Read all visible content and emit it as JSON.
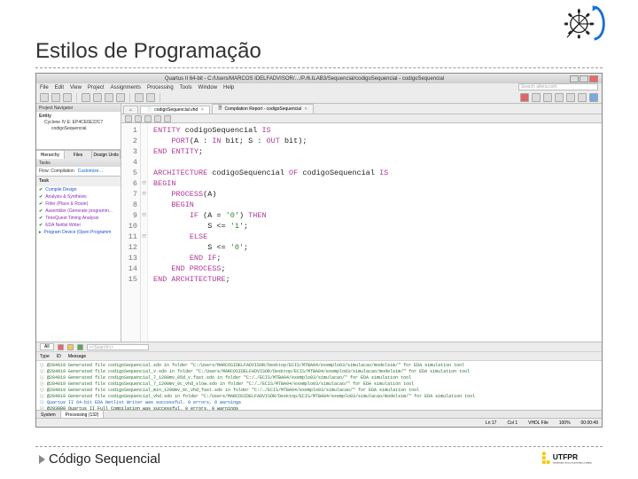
{
  "slide": {
    "title": "Estilos de Programação",
    "caption": "Código Sequencial"
  },
  "brand_top": {
    "name": "gear-compass-logo"
  },
  "brand_bottom": {
    "name": "UTFPR",
    "subtitle": "UNIVERSIDADE TECNOLÓGICA FEDERAL DO PARANÁ"
  },
  "ide": {
    "titlebar": "Quartus II 64-bit - C:/Users/MARCOS IDELFADVISOR/…/P./6.ILAB3/Sequencial/codigoSequencial - codigoSequencial",
    "menu": [
      "File",
      "Edit",
      "View",
      "Project",
      "Assignments",
      "Processing",
      "Tools",
      "Window",
      "Help"
    ],
    "search_placeholder": "Search altera.com",
    "tabs": {
      "active": "codigoSequencial.vhd",
      "inactive": "Compilation Report - codigoSequencial"
    },
    "left": {
      "project_header": "Project Navigator",
      "entity_header": "Entity",
      "device": "Cyclone IV E: EP4CE6E22C7",
      "entity": "codigoSequencial",
      "tabs": [
        "Hierarchy",
        "Files",
        "Design Units"
      ],
      "tasks_header": "Tasks",
      "flow_label": "Flow: Compilation",
      "customize": "Customize…",
      "task_col": "Task",
      "tasks": [
        {
          "ok": true,
          "label": "Compile Design",
          "cls": "task-blue"
        },
        {
          "ok": true,
          "label": "Analysis & Synthesis",
          "cls": "task-purple"
        },
        {
          "ok": true,
          "label": "Fitter (Place & Route)",
          "cls": "task-purple"
        },
        {
          "ok": true,
          "label": "Assembler (Generate programm…",
          "cls": "task-purple"
        },
        {
          "ok": true,
          "label": "TimeQuest Timing Analysis",
          "cls": "task-purple"
        },
        {
          "ok": true,
          "label": "EDA Netlist Writer",
          "cls": "task-purple"
        },
        {
          "ok": false,
          "label": "Program Device (Open Programm",
          "cls": "task-blue"
        }
      ]
    },
    "code": {
      "lines": [
        {
          "n": 1,
          "m": "",
          "html": "<span class='kw'>ENTITY</span> codigoSequencial <span class='kw'>IS</span>"
        },
        {
          "n": 2,
          "m": "",
          "html": "    <span class='kw'>PORT</span>(A : <span class='kw'>IN</span> bit; S : <span class='kw'>OUT</span> bit);"
        },
        {
          "n": 3,
          "m": "",
          "html": "<span class='kw'>END ENTITY</span>;"
        },
        {
          "n": 4,
          "m": "",
          "html": ""
        },
        {
          "n": 5,
          "m": "",
          "html": "<span class='kw'>ARCHITECTURE</span> codigoSequencial <span class='kw'>OF</span> codigoSequencial <span class='kw'>IS</span>"
        },
        {
          "n": 6,
          "m": "⊟",
          "html": "<span class='kw'>BEGIN</span>"
        },
        {
          "n": 7,
          "m": "⊟",
          "html": "    <span class='kw'>PROCESS</span>(A)"
        },
        {
          "n": 8,
          "m": "",
          "html": "    <span class='kw'>BEGIN</span>"
        },
        {
          "n": 9,
          "m": "⊟",
          "html": "        <span class='kw'>IF</span> (A = <span class='lit'>'0'</span>) <span class='kw'>THEN</span>"
        },
        {
          "n": 10,
          "m": "",
          "html": "            S &lt;= <span class='lit'>'1'</span>;"
        },
        {
          "n": 11,
          "m": "⊟",
          "html": "        <span class='kw'>ELSE</span>"
        },
        {
          "n": 12,
          "m": "",
          "html": "            S &lt;= <span class='lit'>'0'</span>;"
        },
        {
          "n": 13,
          "m": "",
          "html": "        <span class='kw'>END IF</span>;"
        },
        {
          "n": 14,
          "m": "",
          "html": "    <span class='kw'>END PROCESS</span>;"
        },
        {
          "n": 15,
          "m": "",
          "html": "<span class='kw'>END ARCHITECTURE</span>;"
        }
      ]
    },
    "bottom": {
      "filter_btn": "All",
      "filter_placeholder": "<<Search>>",
      "tabs": [
        "Type",
        "ID",
        "Message"
      ],
      "messages": [
        "@284019 Generated file codigoSequencial.sdo in folder \"C:/Users/MARCOSIDELFADVISOR/Desktop/ECIS/MTBA04/exemplo03/simulacao/modelsim/\" for EDA simulation tool",
        "@284019 Generated file codigoSequencial_v.sdo in folder \"C:/Users/MARCOSIDELFADVISOR/Desktop/ECIS/MTBA04/exemplo03/simulacao/modelsim/\" for EDA simulation tool",
        "@284019 Generated file codigoSequencial_7_1200mv_85d_v.fast.sdo in folder \"C:/…/ECIS/MTBA04/exemplo03/simulacao/\" for EDA simulation tool",
        "@284019 Generated file codigoSequencial_7_1200mv_0c_vhd_slow.sdo in folder \"C:/…/ECIS/MTBA04/exemplo03/simulacao/\" for EDA simulation tool",
        "@284019 Generated file codigoSequencial_min_1200mv_0c_vhd_fast.sdo in folder \"C:/…/ECIS/MTBA04/exemplo03/simulacao/\" for EDA simulation tool",
        "@284019 Generated file codigoSequencial_vhd.sdo in folder \"C:/Users/MARCOSIDELFADVISOR/Desktop/ECIS/MTBA04/exemplo03/simulacao/modelsim/\" for EDA simulation tool",
        "Quartus II 64-bit EDA Netlist Writer was successful. 0 errors, 0 warnings",
        "@293000 Quartus II Full Compilation was successful. 0 errors, 9 warnings"
      ],
      "msg_classes": [
        "",
        "",
        "",
        "",
        "",
        "",
        "blue",
        "dark"
      ],
      "bottom_tabs": [
        "System",
        "Processing (132)"
      ]
    },
    "status": {
      "left": "                  ",
      "ln": "Ln 17",
      "col": "Col 1",
      "mode": "VHDL File",
      "pct": "100%",
      "time": "00:00:49"
    }
  }
}
